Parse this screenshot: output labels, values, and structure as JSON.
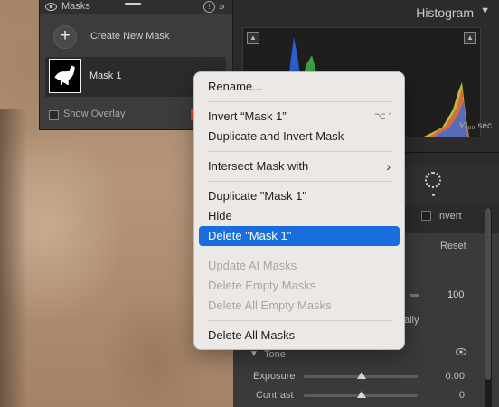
{
  "histogram": {
    "title": "Histogram",
    "shutter": "¹⁄₄₀₀ sec"
  },
  "masks_panel": {
    "title": "Masks",
    "help": "!",
    "expand": "»",
    "create_label": "Create New Mask",
    "mask_name": "Mask 1",
    "show_overlay": "Show Overlay",
    "overlay_color": "#e4432e"
  },
  "mask_edit": {
    "invert_label": "Invert",
    "reset_label": "Reset",
    "amount_value": "100",
    "partial_text": "ally",
    "tone_label": "Tone",
    "sliders": [
      {
        "label": "Exposure",
        "value": "0.00",
        "position": 0.5
      },
      {
        "label": "Contrast",
        "value": "0",
        "position": 0.5
      }
    ]
  },
  "context_menu": {
    "items": [
      {
        "label": "Rename...",
        "enabled": true
      },
      {
        "label": "Invert “Mask 1”",
        "shortcut": "⌥ '",
        "enabled": true
      },
      {
        "label": "Duplicate and Invert Mask",
        "enabled": true
      },
      {
        "label": "Intersect Mask with",
        "submenu": true,
        "enabled": true
      },
      {
        "label": "Duplicate \"Mask 1\"",
        "enabled": true
      },
      {
        "label": "Hide",
        "enabled": true
      },
      {
        "label": "Delete \"Mask 1\"",
        "enabled": true,
        "selected": true
      },
      {
        "label": "Update AI Masks",
        "enabled": false
      },
      {
        "label": "Delete Empty Masks",
        "enabled": false
      },
      {
        "label": "Delete All Empty Masks",
        "enabled": false
      },
      {
        "label": "Delete All Masks",
        "enabled": true
      }
    ]
  },
  "colors": {
    "menu_highlight": "#1a6ddc",
    "panel_bg": "#2b2b2b"
  }
}
